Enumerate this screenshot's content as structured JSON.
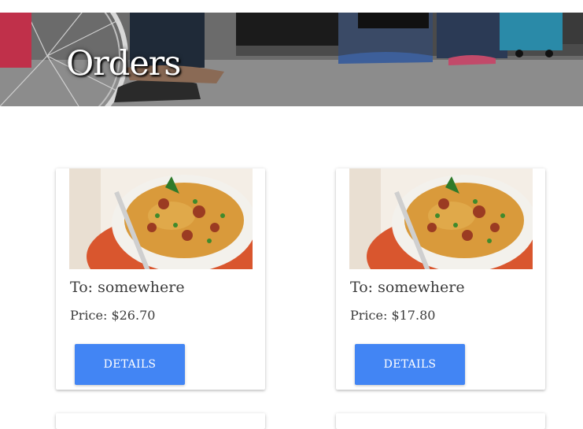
{
  "hero": {
    "title": "Orders"
  },
  "orders": [
    {
      "to": "To: somewhere",
      "price": "Price: $26.70",
      "button_label": "DETAILS",
      "image": "paella-dish-image"
    },
    {
      "to": "To: somewhere",
      "price": "Price: $17.80",
      "button_label": "DETAILS",
      "image": "paella-dish-image"
    }
  ],
  "colors": {
    "button": "#4285f4",
    "text": "#3b3b3b"
  }
}
